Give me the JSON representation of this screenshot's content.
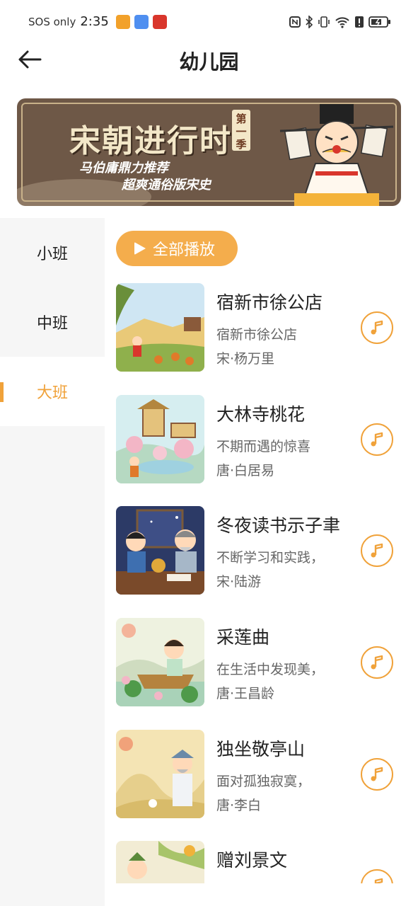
{
  "status_bar": {
    "sos": "SOS only",
    "time": "2:35"
  },
  "header": {
    "title": "幼儿园"
  },
  "banner": {
    "title": "宋朝进行时",
    "season": "第一季",
    "subtitle_1": "马伯庸鼎力推荐",
    "subtitle_2": "超爽通俗版宋史"
  },
  "sidebar": {
    "items": [
      {
        "label": "小班",
        "active": false
      },
      {
        "label": "中班",
        "active": false
      },
      {
        "label": "大班",
        "active": true
      }
    ]
  },
  "main": {
    "play_all_label": "全部播放",
    "items": [
      {
        "title": "宿新市徐公店",
        "desc": "宿新市徐公店",
        "author": "宋·杨万里"
      },
      {
        "title": "大林寺桃花",
        "desc": "不期而遇的惊喜",
        "author": "唐·白居易"
      },
      {
        "title": "冬夜读书示子聿",
        "desc": "不断学习和实践，",
        "author": "宋·陆游"
      },
      {
        "title": "采莲曲",
        "desc": "在生活中发现美，",
        "author": "唐·王昌龄"
      },
      {
        "title": "独坐敬亭山",
        "desc": "面对孤独寂寞，",
        "author": "唐·李白"
      },
      {
        "title": "赠刘景文",
        "desc": "",
        "author": ""
      }
    ]
  },
  "colors": {
    "accent": "#f0a23a",
    "play_all_bg": "#f4ad4c",
    "sidebar_bg": "#f6f6f6"
  },
  "icons": {
    "back": "arrow-left-icon",
    "play": "play-icon",
    "music": "music-note-icon"
  }
}
